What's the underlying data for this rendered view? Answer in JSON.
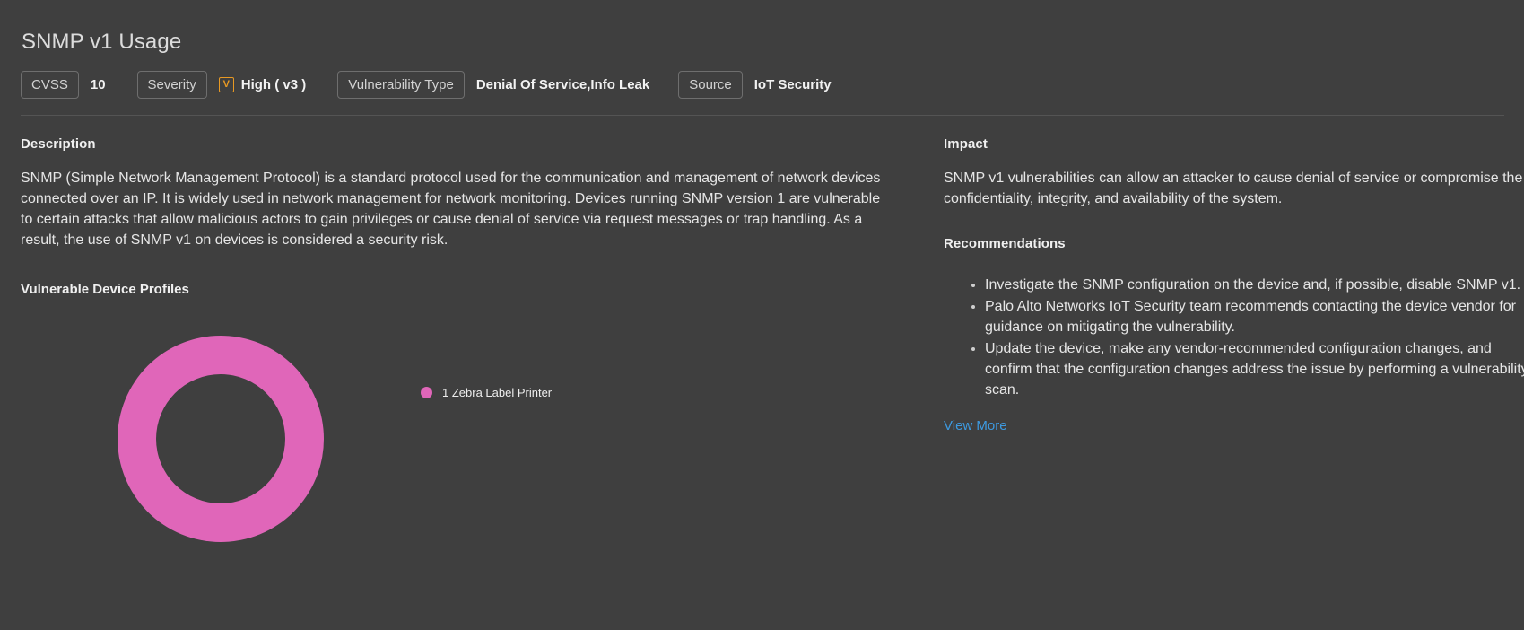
{
  "page_title": "SNMP v1 Usage",
  "meta": {
    "cvss_label": "CVSS",
    "cvss_value": "10",
    "severity_label": "Severity",
    "severity_icon": "vulnerability-square-icon",
    "severity_icon_glyph": "V",
    "severity_value": "High ( v3 )",
    "severity_color": "#e89923",
    "vuln_type_label": "Vulnerability Type",
    "vuln_type_value": "Denial Of Service,Info Leak",
    "source_label": "Source",
    "source_value": "IoT Security"
  },
  "description": {
    "heading": "Description",
    "text": "SNMP (Simple Network Management Protocol) is a standard protocol used for the communication and management of network devices connected over an IP. It is widely used in network management for network monitoring. Devices running SNMP version 1 are vulnerable to certain attacks that allow malicious actors to gain privileges or cause denial of service via request messages or trap handling. As a result, the use of SNMP v1 on devices is considered a security risk."
  },
  "impact": {
    "heading": "Impact",
    "text": "SNMP v1 vulnerabilities can allow an attacker to cause denial of service or compromise the confidentiality, integrity, and availability of the system."
  },
  "recommendations": {
    "heading": "Recommendations",
    "items": [
      "Investigate the SNMP configuration on the device and, if possible, disable SNMP v1.",
      "Palo Alto Networks IoT Security team recommends contacting the device vendor for guidance on mitigating the vulnerability.",
      "Update the device, make any vendor-recommended configuration changes, and confirm that the configuration changes address the issue by performing a vulnerability scan."
    ],
    "view_more_label": "View More"
  },
  "chart_data": {
    "type": "pie",
    "title": "Vulnerable Device Profiles",
    "donut": true,
    "legend_position": "right",
    "categories": [
      "Zebra Label Printer"
    ],
    "values": [
      1
    ],
    "total": 1,
    "colors": [
      "#e066b9"
    ],
    "legend": [
      {
        "label": "1 Zebra Label Printer",
        "count": 1,
        "name": "Zebra Label Printer",
        "color": "#e066b9"
      }
    ]
  }
}
